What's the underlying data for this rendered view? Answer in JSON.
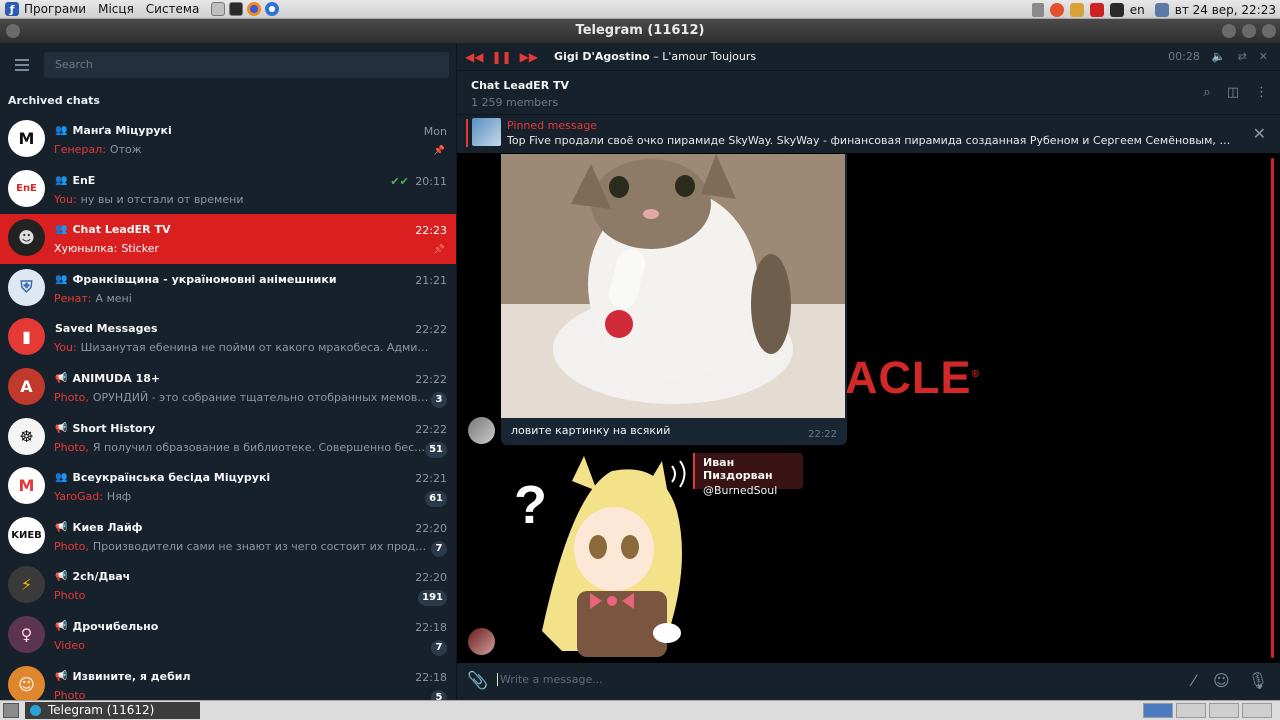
{
  "system_bar": {
    "menu": [
      "Програми",
      "Місця",
      "Система"
    ],
    "keyboard_layout": "en",
    "datetime": "вт 24 вер, 22:23"
  },
  "window": {
    "title": "Telegram (11612)"
  },
  "sidebar": {
    "search_placeholder": "Search",
    "section_title": "Archived chats",
    "chats": [
      {
        "name": "Манґа Міцурукі",
        "time": "Mon",
        "sender": "Генерал:",
        "text": "Отож",
        "badge": "",
        "kind": "group",
        "pinned": true,
        "avatar_color": "#ffffff",
        "avatar_fg": "#111111",
        "avatar_text": "Μ"
      },
      {
        "name": "EnE",
        "time": "20:11",
        "sender": "You:",
        "text": "ну вы и отстали от времени",
        "badge": "",
        "kind": "group",
        "read": true,
        "avatar_color": "#ffffff",
        "avatar_fg": "#d62828",
        "avatar_text": "EnE"
      },
      {
        "name": "Chat LeadER TV",
        "time": "22:23",
        "sender": "Хуюнылка:",
        "text": "Sticker",
        "badge": "",
        "kind": "group",
        "pinned": true,
        "active": true,
        "avatar_color": "#222222",
        "avatar_fg": "#dddddd",
        "avatar_text": "☻"
      },
      {
        "name": "Франківщина - україномовні анімешники",
        "time": "21:21",
        "sender": "Ренат:",
        "text": "А мені",
        "badge": "",
        "kind": "group",
        "avatar_color": "#dfe8f2",
        "avatar_fg": "#3a6ab0",
        "avatar_text": "⛨"
      },
      {
        "name": "Saved Messages",
        "time": "22:22",
        "sender": "You:",
        "text": "Шизанутая ебенина не пойми от какого мракобеса. Админ - @ursna Ск...",
        "badge": "",
        "kind": "saved",
        "avatar_color": "#e53935",
        "avatar_fg": "#ffffff",
        "avatar_text": "▮"
      },
      {
        "name": "ANIMUDA 18+",
        "time": "22:22",
        "sender": "Photo,",
        "text": "ОРУНДИЙ - это собрание тщательно отобранных мемов, гиффок ...",
        "badge": "3",
        "kind": "channel",
        "avatar_color": "#c0392b",
        "avatar_fg": "#ffffff",
        "avatar_text": "A"
      },
      {
        "name": "Short History",
        "time": "22:22",
        "sender": "Photo,",
        "text": "Я получил образование в библиотеке. Совершенно бесплатно. ...",
        "badge": "51",
        "kind": "channel",
        "avatar_color": "#f4f4f4",
        "avatar_fg": "#111111",
        "avatar_text": "☸"
      },
      {
        "name": "Всеукраїнська бесіда Міцурукі",
        "time": "22:21",
        "sender": "YaroGad:",
        "text": "Няф",
        "badge": "61",
        "kind": "group",
        "avatar_color": "#ffffff",
        "avatar_fg": "#e53935",
        "avatar_text": "Μ"
      },
      {
        "name": "Киев Лайф",
        "time": "22:20",
        "sender": "Photo,",
        "text": "Производители сами не знают из чего состоит их продукция 🤹",
        "badge": "7",
        "kind": "channel",
        "avatar_color": "#ffffff",
        "avatar_fg": "#111111",
        "avatar_text": "KИEB"
      },
      {
        "name": "2ch/Двач",
        "time": "22:20",
        "sender": "Photo",
        "text": "",
        "badge": "191",
        "kind": "channel",
        "avatar_color": "#3a3a3a",
        "avatar_fg": "#f7b500",
        "avatar_text": "⚡"
      },
      {
        "name": "Дрочибельно",
        "time": "22:18",
        "sender": "Video",
        "text": "",
        "badge": "7",
        "kind": "channel",
        "avatar_color": "#5b3450",
        "avatar_fg": "#ffd0e0",
        "avatar_text": "♀"
      },
      {
        "name": "Извините, я дебил",
        "time": "22:18",
        "sender": "Photo",
        "text": "",
        "badge": "5",
        "kind": "channel",
        "avatar_color": "#e0862c",
        "avatar_fg": "#ffffff",
        "avatar_text": "☺"
      }
    ]
  },
  "player": {
    "artist": "Gigi D'Agostino",
    "separator": " – ",
    "title": "L'amour Toujours",
    "time": "00:28"
  },
  "chat": {
    "title": "Chat LeadER TV",
    "subtitle": "1 259 members",
    "pinned_title": "Pinned message",
    "pinned_text": "Top Five продали своё очко пирамиде SkyWay.   SkyWay - финансовая пирамида созданная Рубеном и Сергеем Семёновым, бывшими участн...",
    "background_word": "ACLE",
    "background_mark": "®",
    "photo_caption": "ловите картинку на всякий",
    "photo_time": "22:22",
    "reply_name": "Иван Пиздорван",
    "reply_text": "@BurnedSoul",
    "composer_placeholder": "Write a message..."
  },
  "taskbar": {
    "task_label": "Telegram (11612)"
  },
  "colors": {
    "accent": "#e53935",
    "active_row": "#d91f20",
    "sidebar": "#17212b"
  }
}
